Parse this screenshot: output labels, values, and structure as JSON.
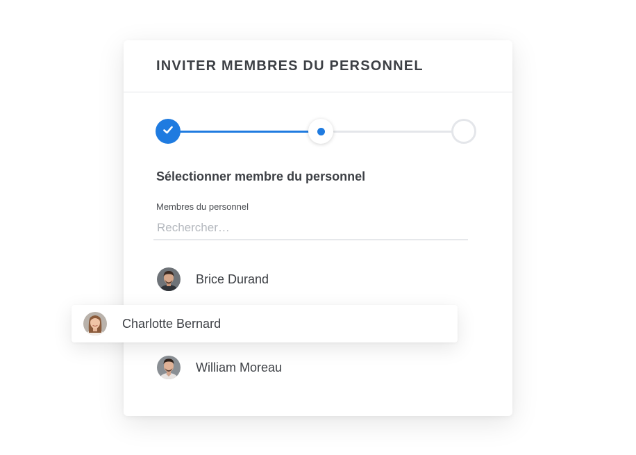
{
  "dialog": {
    "title": "INVITER MEMBRES DU PERSONNEL"
  },
  "stepper": {
    "current_step": 2,
    "total_steps": 3,
    "accent_color": "#1f7be0",
    "steps": [
      {
        "state": "complete",
        "icon": "check-icon"
      },
      {
        "state": "current",
        "icon": "dot-icon"
      },
      {
        "state": "upcoming",
        "icon": ""
      }
    ]
  },
  "section": {
    "heading": "Sélectionner membre du personnel"
  },
  "search": {
    "label": "Membres du personnel",
    "placeholder": "Rechercher…",
    "value": ""
  },
  "members": [
    {
      "name": "Brice Durand",
      "avatar": "avatar-photo-man"
    },
    {
      "name": "Charlotte Bernard",
      "avatar": "avatar-photo-woman",
      "highlighted": true
    },
    {
      "name": "William Moreau",
      "avatar": "avatar-photo-man"
    }
  ]
}
